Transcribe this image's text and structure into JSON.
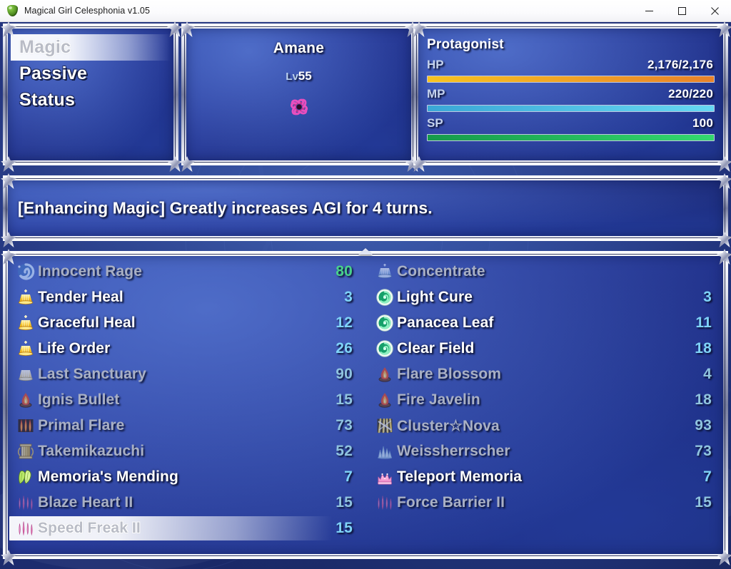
{
  "window": {
    "title": "Magical Girl Celesphonia v1.05",
    "app_icon": "shield-icon",
    "minimize_label": "─",
    "maximize_label": "□",
    "close_label": "✕"
  },
  "menu": {
    "items": [
      {
        "label": "Magic",
        "selected": true
      },
      {
        "label": "Passive",
        "selected": false
      },
      {
        "label": "Status",
        "selected": false
      }
    ]
  },
  "character": {
    "name": "Amane",
    "level_prefix": "Lv",
    "level_value": "55",
    "face_icon": "magic-sigil-icon"
  },
  "stats": {
    "party_name": "Protagonist",
    "gauges": [
      {
        "label": "HP",
        "value": "2,176/2,176",
        "percent": 100,
        "color_from": "#f7c321",
        "color_to": "#e8822a"
      },
      {
        "label": "MP",
        "value": "220/220",
        "percent": 100,
        "color_from": "#3aa7d6",
        "color_to": "#66d8f2"
      },
      {
        "label": "SP",
        "value": "100",
        "percent": 100,
        "color_from": "#169a4b",
        "color_to": "#34d96f"
      }
    ]
  },
  "description": {
    "text": "[Enhancing Magic] Greatly increases AGI for 4 turns."
  },
  "skill_list": {
    "scroll_indicator": "scroll-up-arrow",
    "left_column": [
      {
        "name": "Innocent Rage",
        "cost": "80",
        "icon": "blue-swirl-icon",
        "state": "disabled",
        "cost_style": "cost-green"
      },
      {
        "name": "Tender Heal",
        "cost": "3",
        "icon": "holy-light-icon",
        "state": "enabled",
        "cost_style": "cost-cyan"
      },
      {
        "name": "Graceful Heal",
        "cost": "12",
        "icon": "holy-light-icon",
        "state": "enabled",
        "cost_style": "cost-cyan"
      },
      {
        "name": "Life Order",
        "cost": "26",
        "icon": "holy-light-icon",
        "state": "enabled",
        "cost_style": "cost-cyan"
      },
      {
        "name": "Last Sanctuary",
        "cost": "90",
        "icon": "pale-light-icon",
        "state": "disabled",
        "cost_style": "cost-dim"
      },
      {
        "name": "Ignis Bullet",
        "cost": "15",
        "icon": "flame-icon",
        "state": "disabled",
        "cost_style": "cost-dim"
      },
      {
        "name": "Primal Flare",
        "cost": "73",
        "icon": "triple-flame-icon",
        "state": "disabled",
        "cost_style": "cost-dim"
      },
      {
        "name": "Takemikazuchi",
        "cost": "52",
        "icon": "gold-pillar-icon",
        "state": "disabled",
        "cost_style": "cost-dim"
      },
      {
        "name": "Memoria's Mending",
        "cost": "7",
        "icon": "green-cloth-icon",
        "state": "enabled",
        "cost_style": "cost-cyan"
      },
      {
        "name": "Blaze Heart II",
        "cost": "15",
        "icon": "pink-spikes-icon",
        "state": "disabled",
        "cost_style": "cost-dim"
      },
      {
        "name": "Speed Freak II",
        "cost": "15",
        "icon": "pink-spikes-icon",
        "state": "selected",
        "cost_style": "cost-cyan"
      }
    ],
    "right_column": [
      {
        "name": "Concentrate",
        "cost": "",
        "icon": "blue-light-icon",
        "state": "disabled",
        "cost_style": "cost-dim"
      },
      {
        "name": "Light Cure",
        "cost": "3",
        "icon": "green-orb-icon",
        "state": "enabled",
        "cost_style": "cost-cyan"
      },
      {
        "name": "Panacea Leaf",
        "cost": "11",
        "icon": "green-orb-icon",
        "state": "enabled",
        "cost_style": "cost-cyan"
      },
      {
        "name": "Clear Field",
        "cost": "18",
        "icon": "green-orb-icon",
        "state": "enabled",
        "cost_style": "cost-cyan"
      },
      {
        "name": "Flare Blossom",
        "cost": "4",
        "icon": "flame-icon",
        "state": "disabled",
        "cost_style": "cost-dim"
      },
      {
        "name": "Fire Javelin",
        "cost": "18",
        "icon": "flame-icon",
        "state": "disabled",
        "cost_style": "cost-dim"
      },
      {
        "name": "Cluster☆Nova",
        "cost": "93",
        "icon": "yellow-beams-icon",
        "state": "disabled",
        "cost_style": "cost-dim"
      },
      {
        "name": "Weissherrscher",
        "cost": "73",
        "icon": "ice-crystal-icon",
        "state": "disabled",
        "cost_style": "cost-dim"
      },
      {
        "name": "Teleport Memoria",
        "cost": "7",
        "icon": "pink-crown-icon",
        "state": "enabled",
        "cost_style": "cost-cyan"
      },
      {
        "name": "Force Barrier II",
        "cost": "15",
        "icon": "pink-spikes-icon",
        "state": "disabled",
        "cost_style": "cost-dim"
      }
    ]
  }
}
